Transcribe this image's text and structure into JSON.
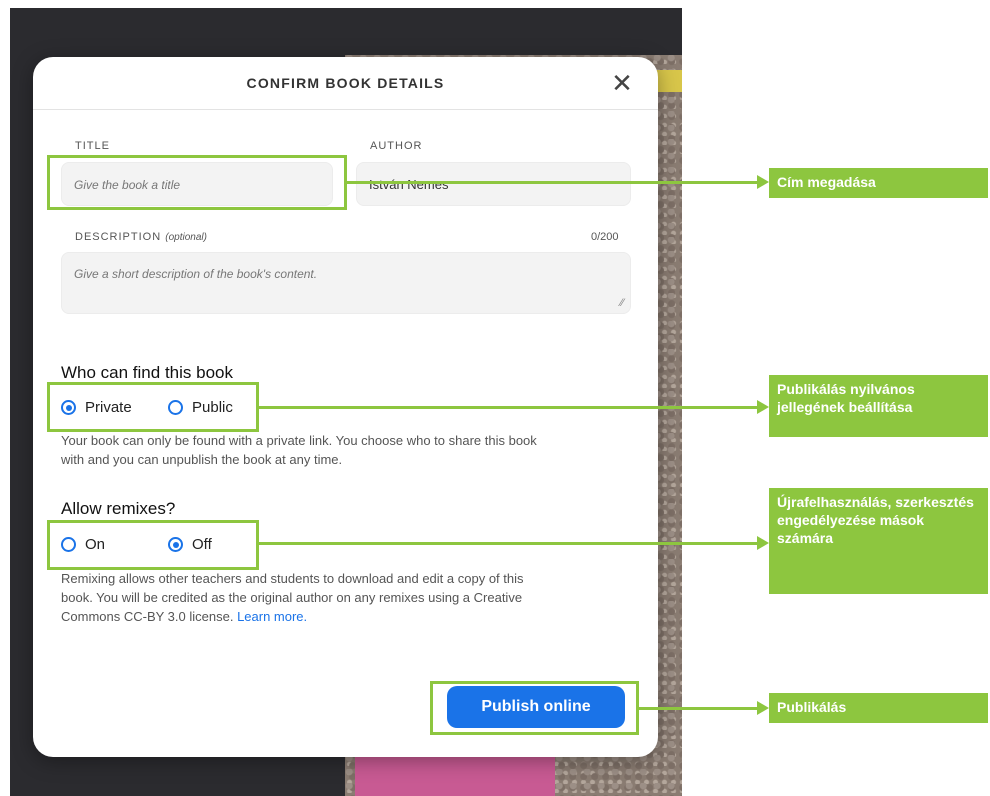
{
  "dialog": {
    "title": "CONFIRM BOOK DETAILS",
    "close_glyph": "✕",
    "title_label": "TITLE",
    "title_placeholder": "Give the book a title",
    "author_label": "AUTHOR",
    "author_value": "István Nemes",
    "description_label": "DESCRIPTION",
    "description_optional": "(optional)",
    "description_counter": "0/200",
    "description_placeholder": "Give a short description of the book's content.",
    "visibility_heading": "Who can find this book",
    "visibility_options": [
      {
        "label": "Private",
        "checked": true
      },
      {
        "label": "Public",
        "checked": false
      }
    ],
    "visibility_help": "Your book can only be found with a private link. You choose who to share this book with and you can unpublish the book at any time.",
    "remix_heading": "Allow remixes?",
    "remix_options": [
      {
        "label": "On",
        "checked": false
      },
      {
        "label": "Off",
        "checked": true
      }
    ],
    "remix_help": "Remixing allows other teachers and students to download and edit a copy of this book. You will be credited as the original author on any remixes using a Creative Commons CC-BY 3.0 license.",
    "learn_more": "Learn more.",
    "publish_label": "Publish online"
  },
  "annotations": {
    "title_callout": "Cím megadása",
    "visibility_callout": "Publikálás nyilvános jellegének beállítása",
    "remix_callout": "Újrafelhasználás, szerkesztés engedélyezése mások számára",
    "publish_callout": "Publikálás"
  },
  "colors": {
    "accent": "#1a73e8",
    "annotation_green": "#8dc63f",
    "backdrop": "#2b2b2f"
  }
}
